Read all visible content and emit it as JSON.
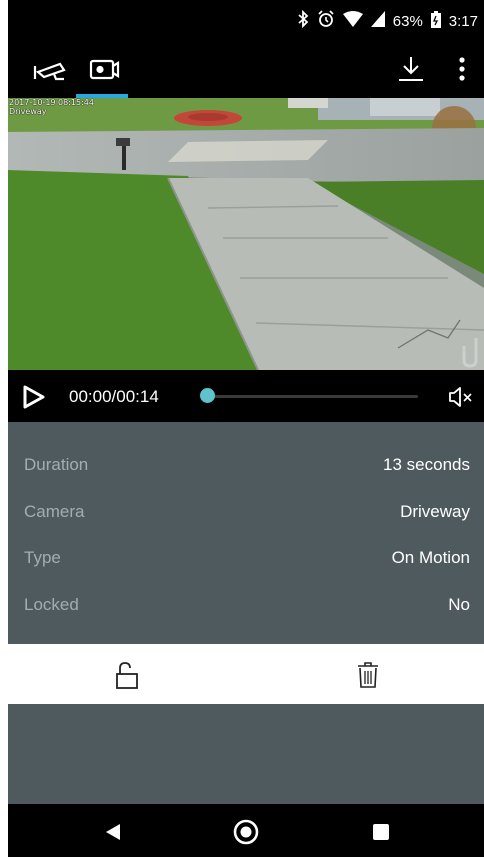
{
  "status_bar": {
    "battery": "63%",
    "time": "3:17",
    "icons": [
      "bluetooth-icon",
      "alarm-icon",
      "wifi-icon",
      "signal-icon",
      "battery-icon"
    ]
  },
  "toolbar": {
    "icons": [
      "cctv-camera-icon",
      "video-recording-icon",
      "download-icon",
      "more-vert-icon"
    ],
    "accent": "#29a8e0"
  },
  "video": {
    "timestamp": "2017-10-19 08:15:44",
    "camera_label": "Driveway"
  },
  "player": {
    "time": "00:00/00:14",
    "progress": 0,
    "accent": "#5ec3cc"
  },
  "details": {
    "rows": [
      {
        "label": "Duration",
        "value": "13 seconds"
      },
      {
        "label": "Camera",
        "value": "Driveway"
      },
      {
        "label": "Type",
        "value": "On Motion"
      },
      {
        "label": "Locked",
        "value": "No"
      }
    ],
    "background": "#4f5a5f"
  },
  "actions": {
    "icons": [
      "unlock-icon",
      "trash-icon"
    ]
  },
  "navbar": {
    "icons": [
      "back-icon",
      "home-icon",
      "recents-icon"
    ]
  }
}
